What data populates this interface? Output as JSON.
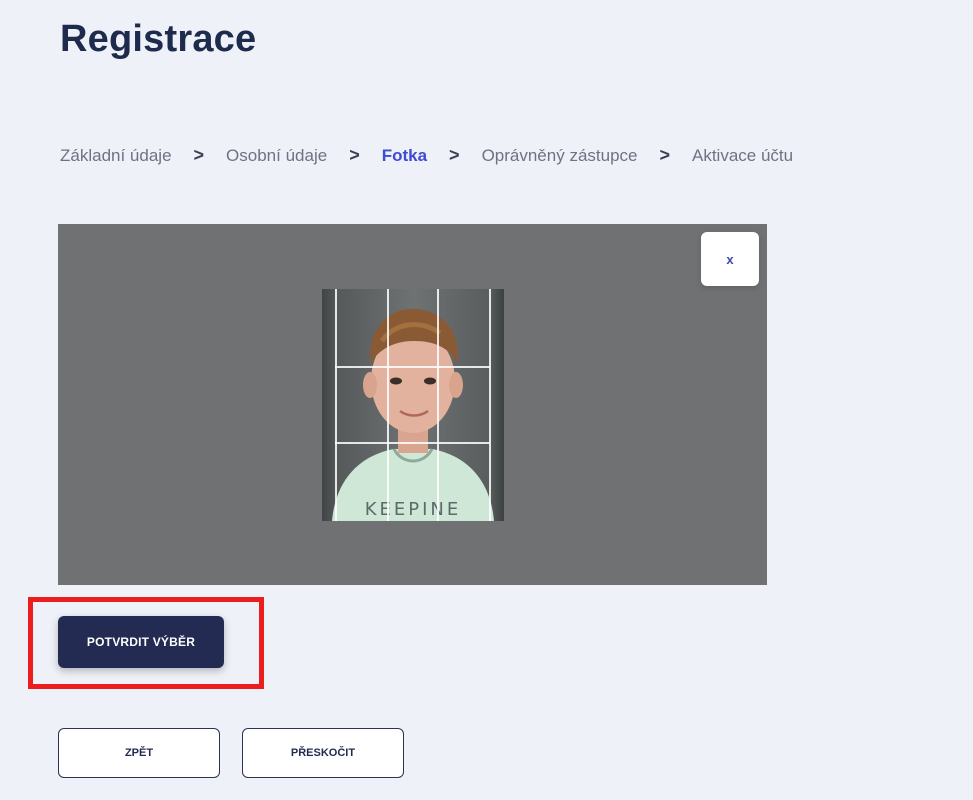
{
  "page": {
    "title": "Registrace"
  },
  "stepper": {
    "steps": [
      {
        "label": "Základní údaje",
        "active": false
      },
      {
        "label": "Osobní údaje",
        "active": false
      },
      {
        "label": "Fotka",
        "active": true
      },
      {
        "label": "Oprávněný zástupce",
        "active": false
      },
      {
        "label": "Aktivace účtu",
        "active": false
      }
    ],
    "separator": ">"
  },
  "crop": {
    "close_label": "x",
    "photo_shirt_text": "KEEPINE"
  },
  "actions": {
    "confirm_label": "POTVRDIT VÝBĚR",
    "back_label": "ZPĚT",
    "skip_label": "PŘESKOČIT"
  },
  "colors": {
    "accent": "#3e4bd4",
    "primary_button": "#232b52",
    "highlight_border": "#ee1d1d",
    "crop_background": "#6f7173",
    "page_background": "#eef1f8"
  }
}
